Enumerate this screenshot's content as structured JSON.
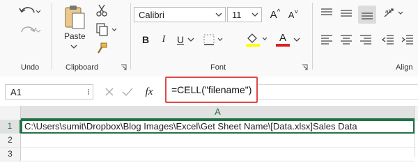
{
  "ribbon": {
    "groups": {
      "undo": "Undo",
      "clipboard": "Clipboard",
      "font": "Font",
      "alignment": "Align"
    },
    "paste_label": "Paste",
    "font_name": "Calibri",
    "font_size": "11",
    "bold": "B",
    "italic": "I",
    "underline": "U",
    "font_color_letter": "A",
    "grow_font": "A",
    "shrink_font": "A",
    "colors": {
      "highlight": "#ffff00",
      "font_color": "#e02020"
    }
  },
  "formula_bar": {
    "name_box": "A1",
    "fx": "fx",
    "formula": "=CELL(\"filename\")"
  },
  "sheet": {
    "column_header": "A",
    "rows": [
      {
        "number": "1",
        "value": "C:\\Users\\sumit\\Dropbox\\Blog Images\\Excel\\Get Sheet Name\\[Data.xlsx]Sales Data"
      },
      {
        "number": "2",
        "value": ""
      },
      {
        "number": "3",
        "value": ""
      }
    ],
    "accent": "#217346"
  }
}
